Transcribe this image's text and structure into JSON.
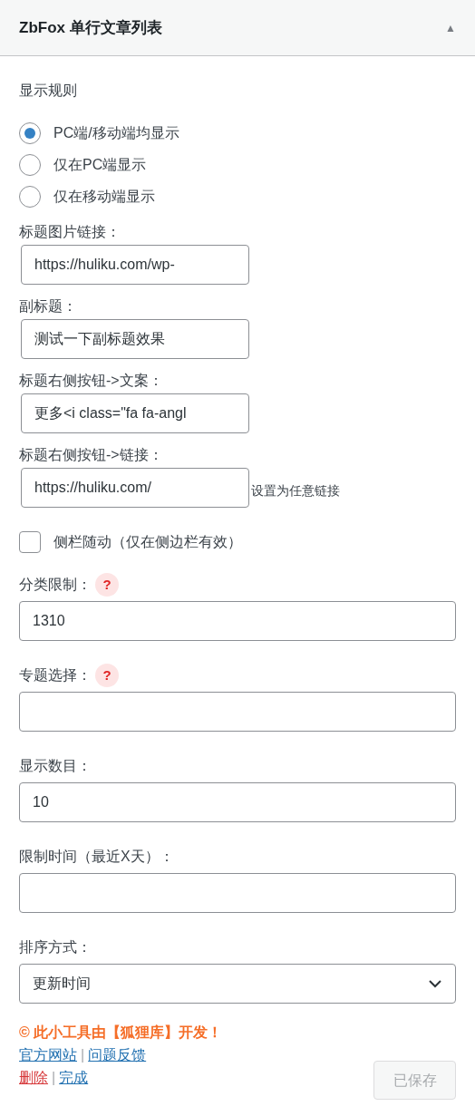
{
  "widget": {
    "title": "ZbFox 单行文章列表",
    "toggle": "▲",
    "expanded": true
  },
  "display_rule": {
    "label": "显示规则",
    "options": [
      {
        "label": "PC端/移动端均显示",
        "selected": true
      },
      {
        "label": "仅在PC端显示",
        "selected": false
      },
      {
        "label": "仅在移动端显示",
        "selected": false
      }
    ]
  },
  "short_fields": [
    {
      "label": "标题图片链接：",
      "value": "https://huliku.com/wp-"
    },
    {
      "label": "副标题：",
      "value": "测试一下副标题效果"
    },
    {
      "label": "标题右侧按钮->文案：",
      "value": "更多<i class=\"fa fa-angl"
    },
    {
      "label": "标题右侧按钮->链接：",
      "value": "https://huliku.com/",
      "note": "设置为任意链接"
    }
  ],
  "sticky": {
    "label": "侧栏随动（仅在侧边栏有效）",
    "checked": false
  },
  "fields": [
    {
      "kind": "text",
      "label": "分类限制：",
      "help": "?",
      "value": "1310"
    },
    {
      "kind": "text",
      "label": "专题选择：",
      "help": "?"
    },
    {
      "kind": "text",
      "label": "显示数目：",
      "value": "10"
    },
    {
      "kind": "text",
      "label": "限制时间（最近X天）："
    },
    {
      "kind": "select",
      "label": "排序方式：",
      "value": "更新时间"
    }
  ],
  "credit": "© 此小工具由【狐狸库】开发！",
  "link_rows": [
    [
      {
        "kind": "link",
        "text": "官方网站"
      },
      {
        "kind": "sep",
        "text": "|"
      },
      {
        "kind": "link",
        "text": "问题反馈"
      }
    ],
    [
      {
        "kind": "danger",
        "text": "删除"
      },
      {
        "kind": "sep",
        "text": "|"
      },
      {
        "kind": "link",
        "text": "完成"
      }
    ]
  ],
  "save_button": {
    "label": "已保存",
    "disabled": true
  }
}
